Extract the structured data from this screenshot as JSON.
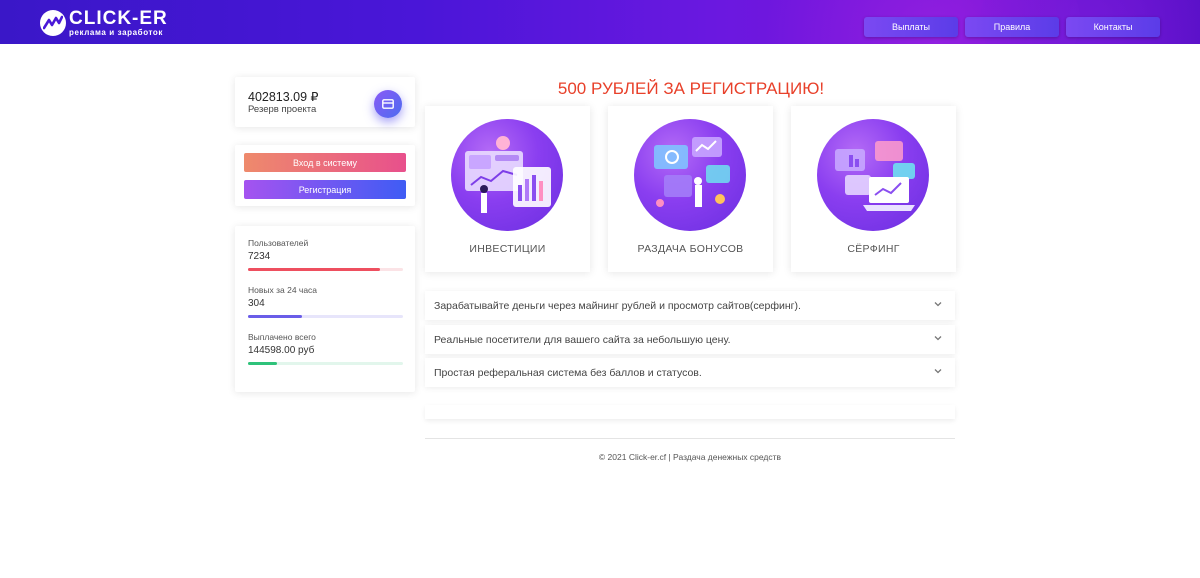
{
  "header": {
    "logo": {
      "title": "CLICK-ER",
      "subtitle": "реклама и заработок",
      "icon": "chart-zigzag-icon"
    },
    "nav": [
      {
        "label": "Выплаты"
      },
      {
        "label": "Правила"
      },
      {
        "label": "Контакты"
      }
    ]
  },
  "sidebar": {
    "reserve": {
      "amount": "402813.09 ₽",
      "label": "Резерв проекта",
      "icon": "wallet-card-icon"
    },
    "auth": {
      "login_label": "Вход в систему",
      "register_label": "Регистрация"
    },
    "stats": [
      {
        "label": "Пользователей",
        "value": "7234",
        "progress": 0.85,
        "color": "#ee4f5f",
        "track": "#fbe3e6"
      },
      {
        "label": "Новых за 24 часа",
        "value": "304",
        "progress": 0.35,
        "color": "#6a5de8",
        "track": "#e7e5fb"
      },
      {
        "label": "Выплачено всего",
        "value": "144598.00 руб",
        "progress": 0.19,
        "color": "#2fc27a",
        "track": "#e2f6ec"
      }
    ]
  },
  "main": {
    "promo": "500 РУБЛЕЙ ЗА РЕГИСТРАЦИЮ!",
    "features": [
      {
        "caption": "ИНВЕСТИЦИИ",
        "icon": "investment-dashboard-illustration"
      },
      {
        "caption": "РАЗДАЧА БОНУСОВ",
        "icon": "bonus-screens-illustration"
      },
      {
        "caption": "СЁРФИНГ",
        "icon": "surfing-laptop-illustration"
      }
    ],
    "accordion": [
      {
        "text": "Зарабатывайте деньги через майнинг рублей и просмотр сайтов(серфинг)."
      },
      {
        "text": "Реальные посетители для вашего сайта за небольшую цену."
      },
      {
        "text": "Простая реферальная система без баллов и статусов."
      }
    ]
  },
  "footer": {
    "text": "© 2021  Click-er.cf | Раздача денежных средств"
  },
  "colors": {
    "header_start": "#3a17c8",
    "header_end": "#7a12d6",
    "promo": "#e8402a"
  }
}
